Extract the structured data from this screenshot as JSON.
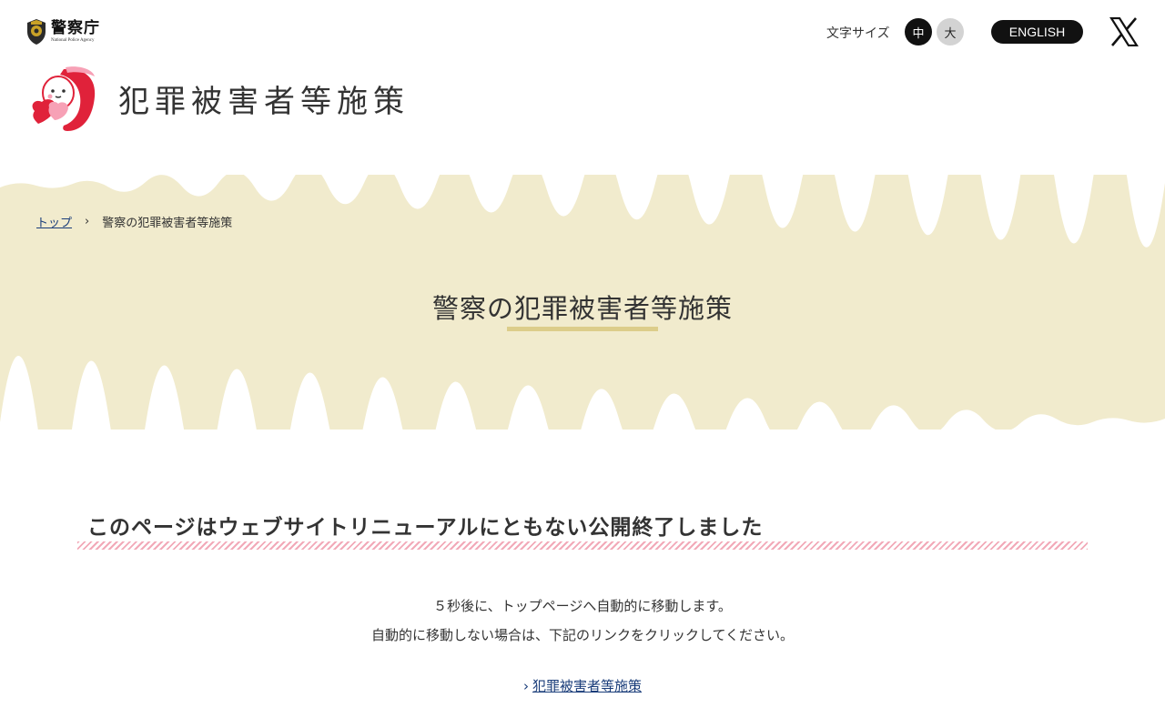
{
  "header": {
    "npa_logo_text": "警察庁",
    "npa_logo_subtext": "National Police Agency",
    "font_size_label": "文字サイズ",
    "font_size_medium": "中",
    "font_size_large": "大",
    "english_label": "ENGLISH",
    "site_title": "犯罪被害者等施策"
  },
  "breadcrumb": {
    "top_label": "トップ",
    "separator": "›",
    "current": "警察の犯罪被害者等施策"
  },
  "page": {
    "title": "警察の犯罪被害者等施策"
  },
  "notice": {
    "heading": "このページはウェブサイトリニューアルにともない公開終了しました",
    "message_line1": "５秒後に、トップページへ自動的に移動します。",
    "message_line2": "自動的に移動しない場合は、下記のリンクをクリックしてください。",
    "link_arrow": "›",
    "link_label": "犯罪被害者等施策"
  },
  "colors": {
    "hero_background": "#f1ebcd",
    "title_underline": "#dccd8a",
    "link": "#1a3d7a",
    "stripe": "#f2a9b8",
    "mascot_red": "#e0223a",
    "mascot_pink": "#f7a1b6"
  },
  "icons": {
    "npa_emblem": "police-emblem-icon",
    "x_logo": "x-logo-icon",
    "mascot": "mascot-icon"
  }
}
